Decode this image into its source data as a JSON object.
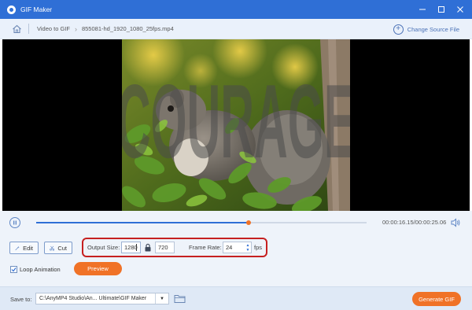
{
  "app": {
    "title": "GIF Maker"
  },
  "window_controls": {
    "minimize": "—",
    "maximize": "□",
    "close": "✕"
  },
  "breadcrumb": {
    "item1": "Video to GIF",
    "item2": "855081-hd_1920_1080_25fps.mp4"
  },
  "change_source": {
    "label": "Change Source File"
  },
  "video": {
    "watermark": "COURAGE"
  },
  "playback": {
    "current_time": "00:00:16.15",
    "total_time": "00:00:25.06",
    "progress": 0.644
  },
  "tools": {
    "edit": "Edit",
    "cut": "Cut"
  },
  "output": {
    "size_label": "Output Size:",
    "width": "1280",
    "height": "720",
    "frame_rate_label": "Frame Rate:",
    "frame_rate": "24",
    "fps_unit": "fps"
  },
  "options": {
    "loop_label": "Loop Animation",
    "loop_checked": true,
    "preview": "Preview"
  },
  "footer": {
    "save_to_label": "Save to:",
    "save_path": "C:\\AnyMP4 Studio\\An... Ultimate\\GIF Maker",
    "generate": "Generate GIF"
  },
  "colors": {
    "accent": "#2f6fd6",
    "orange": "#f07227",
    "highlight": "#c62020"
  }
}
